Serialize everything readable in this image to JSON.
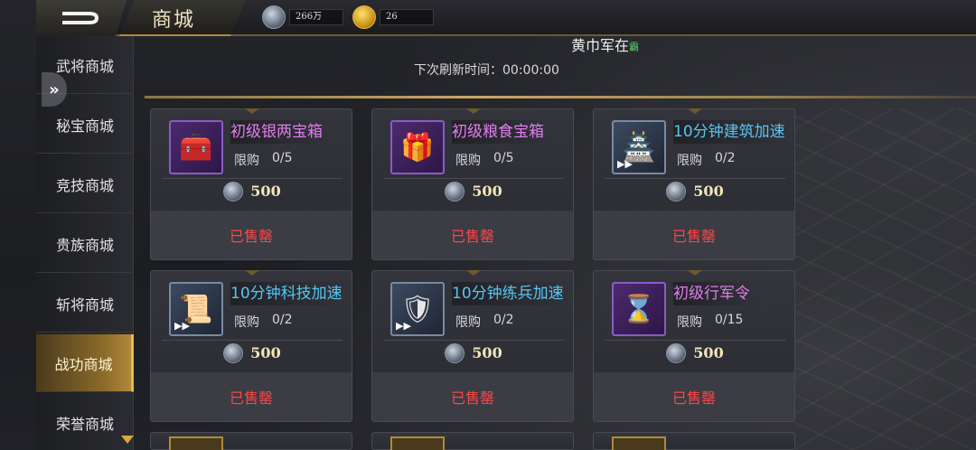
{
  "header": {
    "title": "商城",
    "silver_amount": "266万",
    "gold_amount": "26"
  },
  "marquee": {
    "text": "黄巾军在",
    "flag": "霸"
  },
  "refresh": {
    "label": "下次刷新时间：",
    "time": "00:00:00"
  },
  "sidebar": {
    "items": [
      {
        "label": "武将商城",
        "active": false
      },
      {
        "label": "秘宝商城",
        "active": false
      },
      {
        "label": "竞技商城",
        "active": false
      },
      {
        "label": "贵族商城",
        "active": false
      },
      {
        "label": "斩将商城",
        "active": false
      },
      {
        "label": "战功商城",
        "active": true
      },
      {
        "label": "荣誉商城",
        "active": false
      }
    ]
  },
  "cards": [
    {
      "name": "初级银两宝箱",
      "name_color": "purple",
      "icon": "silver-chest-icon",
      "limit_label": "限购",
      "limit": "0/5",
      "price": "500",
      "status": "已售罄"
    },
    {
      "name": "初级粮食宝箱",
      "name_color": "purple",
      "icon": "food-chest-icon",
      "limit_label": "限购",
      "limit": "0/5",
      "price": "500",
      "status": "已售罄"
    },
    {
      "name": "10分钟建筑加速",
      "name_color": "cyan",
      "icon": "building-speedup-icon",
      "limit_label": "限购",
      "limit": "0/2",
      "price": "500",
      "status": "已售罄"
    },
    {
      "name": "10分钟科技加速",
      "name_color": "cyan",
      "icon": "tech-speedup-icon",
      "limit_label": "限购",
      "limit": "0/2",
      "price": "500",
      "status": "已售罄"
    },
    {
      "name": "10分钟练兵加速",
      "name_color": "cyan",
      "icon": "training-speedup-icon",
      "limit_label": "限购",
      "limit": "0/2",
      "price": "500",
      "status": "已售罄"
    },
    {
      "name": "初级行军令",
      "name_color": "purple",
      "icon": "march-order-icon",
      "limit_label": "限购",
      "limit": "0/15",
      "price": "500",
      "status": "已售罄"
    }
  ],
  "colors": {
    "sold_out": "#ff4646",
    "rare_purple": "#e07df0",
    "rare_cyan": "#56c6f2",
    "active_tab": "#b0893a"
  }
}
